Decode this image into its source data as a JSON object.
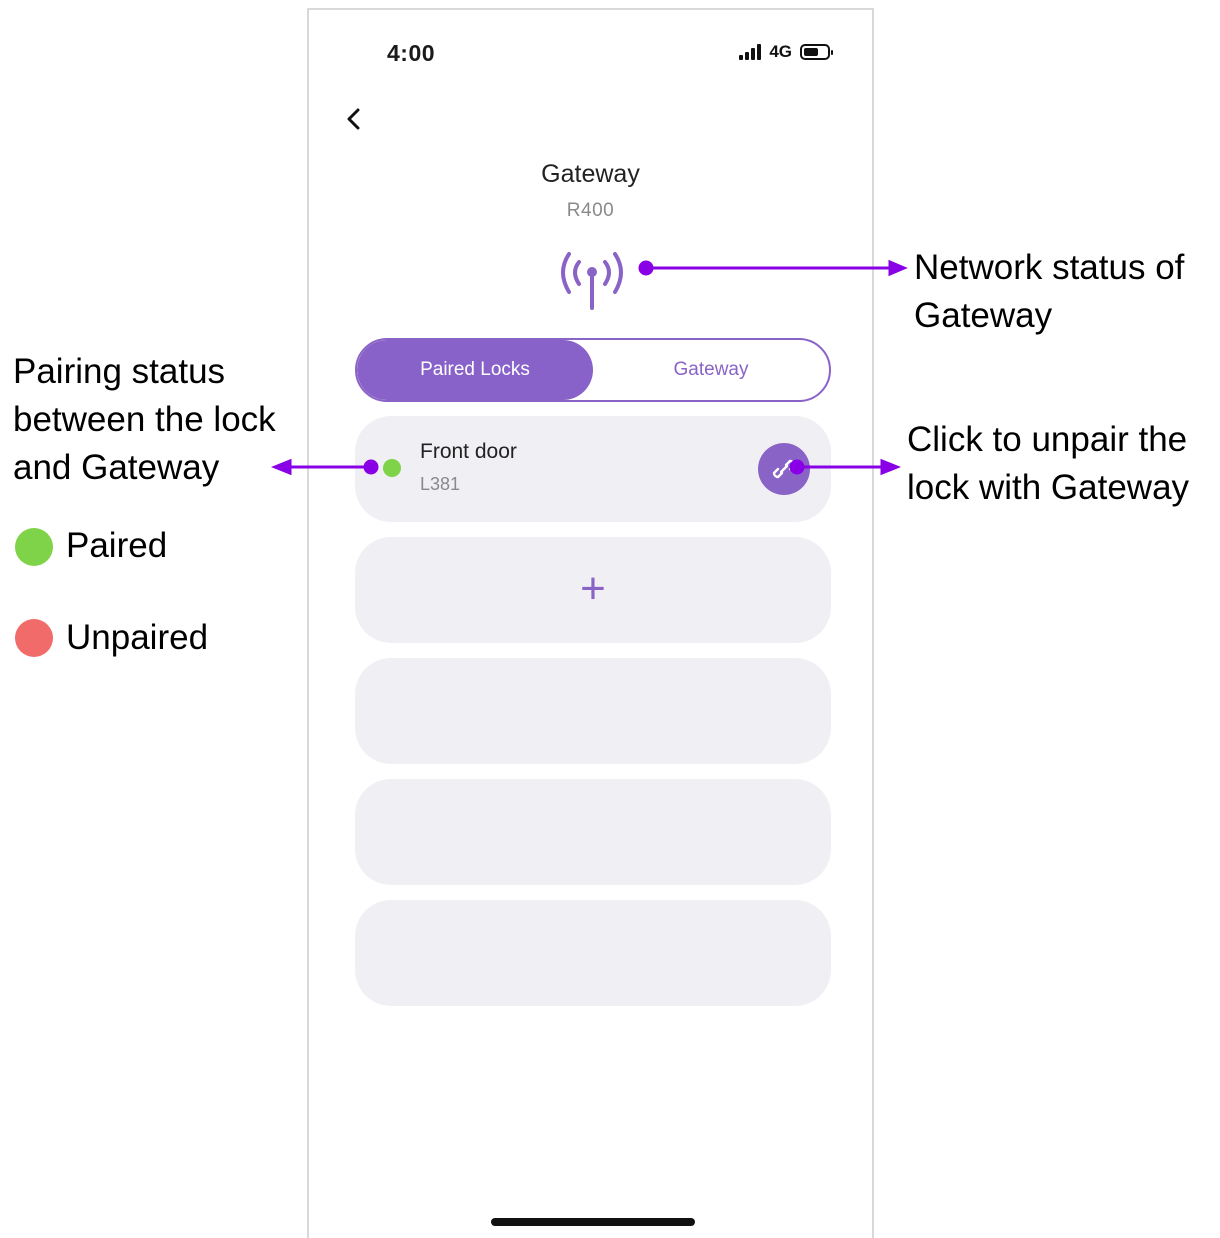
{
  "status_bar": {
    "time": "4:00",
    "network": "4G"
  },
  "header": {
    "title": "Gateway",
    "subtitle": "R400"
  },
  "tabs": [
    {
      "label": "Paired Locks",
      "active": true
    },
    {
      "label": "Gateway",
      "active": false
    }
  ],
  "locks": [
    {
      "name": "Front door",
      "model": "L381",
      "status": "paired"
    }
  ],
  "add_button": {
    "label": "+"
  },
  "annotations": {
    "network_status": [
      "Network status of",
      "Gateway"
    ],
    "pairing_status": [
      "Pairing status",
      "between the lock",
      "and Gateway"
    ],
    "unpair": [
      "Click to unpair the",
      "lock with Gateway"
    ],
    "legend_paired": "Paired",
    "legend_unpaired": "Unpaired"
  },
  "colors": {
    "accent": "#8862c9",
    "paired": "#7ed348",
    "unpaired": "#f26b6b",
    "annotation_arrow": "#8a00e6"
  },
  "icons": {
    "back": "chevron-left-icon",
    "gateway_signal": "antenna-signal-icon",
    "unpair": "unlink-icon"
  }
}
